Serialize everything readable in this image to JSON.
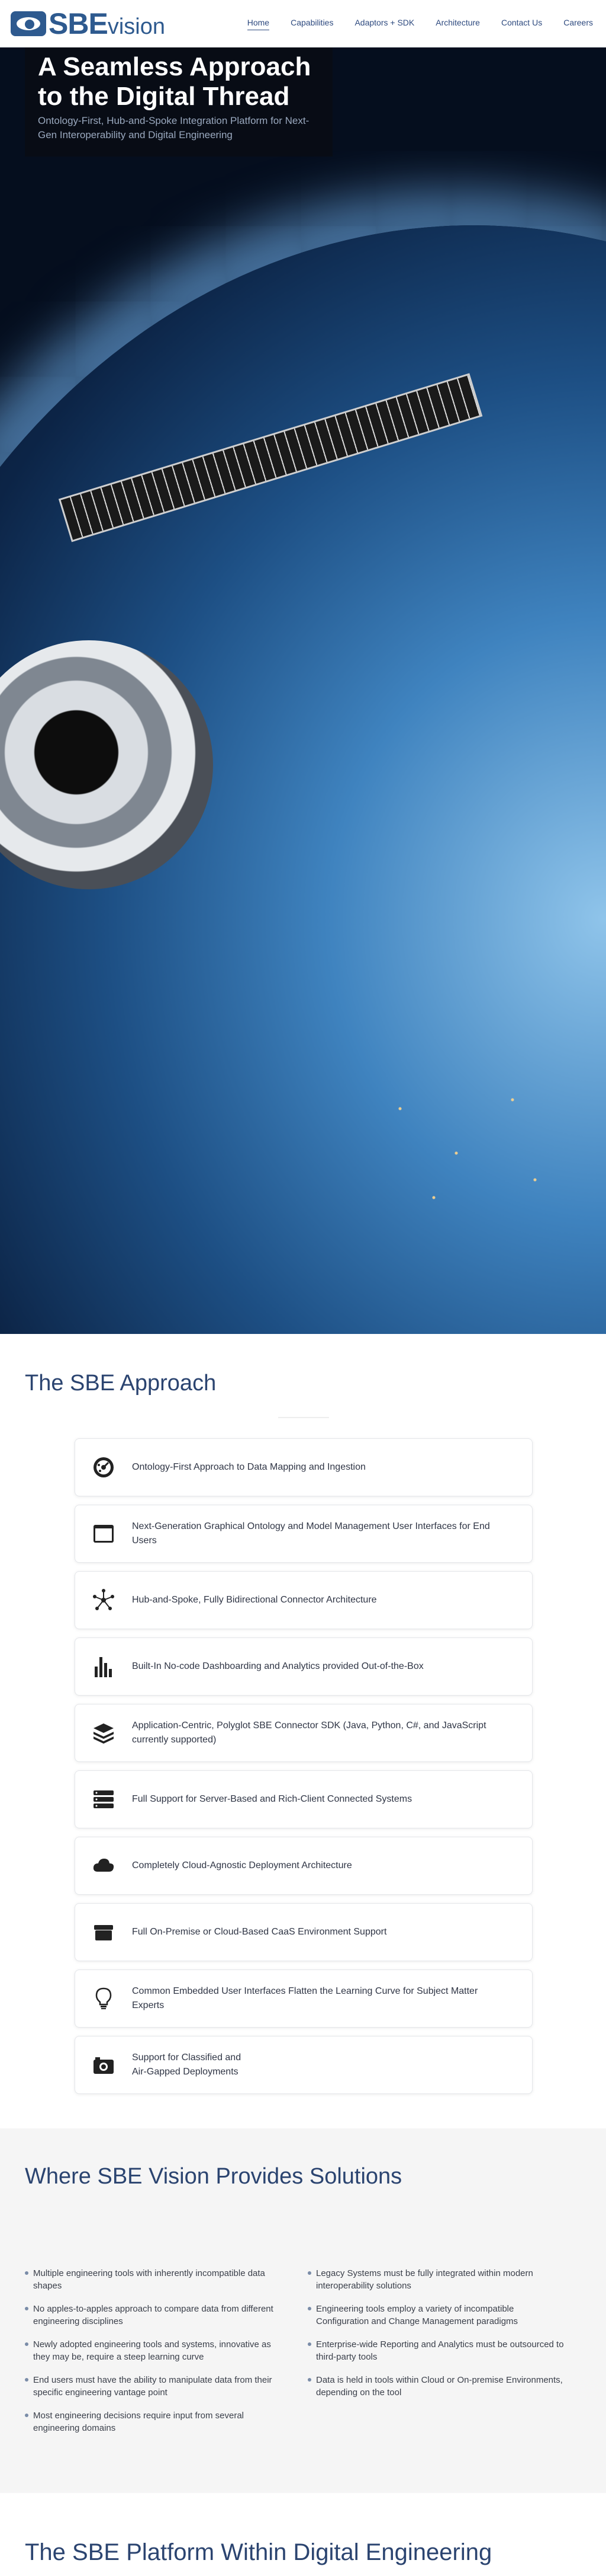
{
  "header": {
    "logo": {
      "sbe": "SBE",
      "vision": "vision"
    },
    "nav": [
      {
        "label": "Home",
        "active": true
      },
      {
        "label": "Capabilities",
        "active": false
      },
      {
        "label": "Adaptors + SDK",
        "active": false
      },
      {
        "label": "Architecture",
        "active": false
      },
      {
        "label": "Contact Us",
        "active": false
      },
      {
        "label": "Careers",
        "active": false
      }
    ]
  },
  "hero": {
    "title": "A Seamless Approach to the Digital Thread",
    "subtitle": "Ontology-First, Hub-and-Spoke Integration Platform for Next-Gen Interoperability and Digital Engineering"
  },
  "approach": {
    "title": "The SBE Approach",
    "items": [
      {
        "icon": "dashboard-gauge-icon",
        "text": "Ontology-First Approach to Data Mapping and Ingestion"
      },
      {
        "icon": "browser-window-icon",
        "text": "Next-Generation Graphical Ontology and Model Management User Interfaces for End Users"
      },
      {
        "icon": "hub-spoke-icon",
        "text": "Hub-and-Spoke, Fully Bidirectional Connector Architecture"
      },
      {
        "icon": "bar-chart-icon",
        "text": "Built-In No-code Dashboarding and Analytics provided Out-of-the-Box"
      },
      {
        "icon": "layers-icon",
        "text": "Application-Centric, Polyglot SBE Connector SDK (Java, Python, C#, and JavaScript currently supported)"
      },
      {
        "icon": "server-icon",
        "text": "Full Support for Server-Based and Rich-Client Connected Systems"
      },
      {
        "icon": "cloud-icon",
        "text": "Completely Cloud-Agnostic Deployment Architecture"
      },
      {
        "icon": "box-icon",
        "text": "Full On-Premise or Cloud-Based CaaS Environment Support"
      },
      {
        "icon": "lightbulb-icon",
        "text": "Common Embedded User Interfaces Flatten the Learning Curve for Subject Matter Experts"
      },
      {
        "icon": "camera-icon",
        "text": "Support for Classified and Air-Gapped Deployments"
      }
    ]
  },
  "solutions": {
    "title": "Where SBE Vision Provides Solutions",
    "left": [
      "Multiple engineering tools with inherently incompatible data shapes",
      "No apples-to-apples approach to compare data from different engineering disciplines",
      "Newly adopted engineering tools and systems, innovative as they may be, require a steep learning curve",
      "End users must have the ability to manipulate data from their specific engineering vantage point",
      "Most engineering decisions require input from several engineering domains"
    ],
    "right": [
      "Legacy Systems must be fully integrated within modern interoperability solutions",
      "Engineering tools employ a variety of incompatible Configuration and Change Management paradigms",
      "Enterprise-wide Reporting and Analytics must be outsourced to third-party tools",
      "Data is held in tools within Cloud or On-premise Environments, depending on the tool"
    ]
  },
  "platform": {
    "title": "The SBE Platform Within Digital Engineering"
  }
}
